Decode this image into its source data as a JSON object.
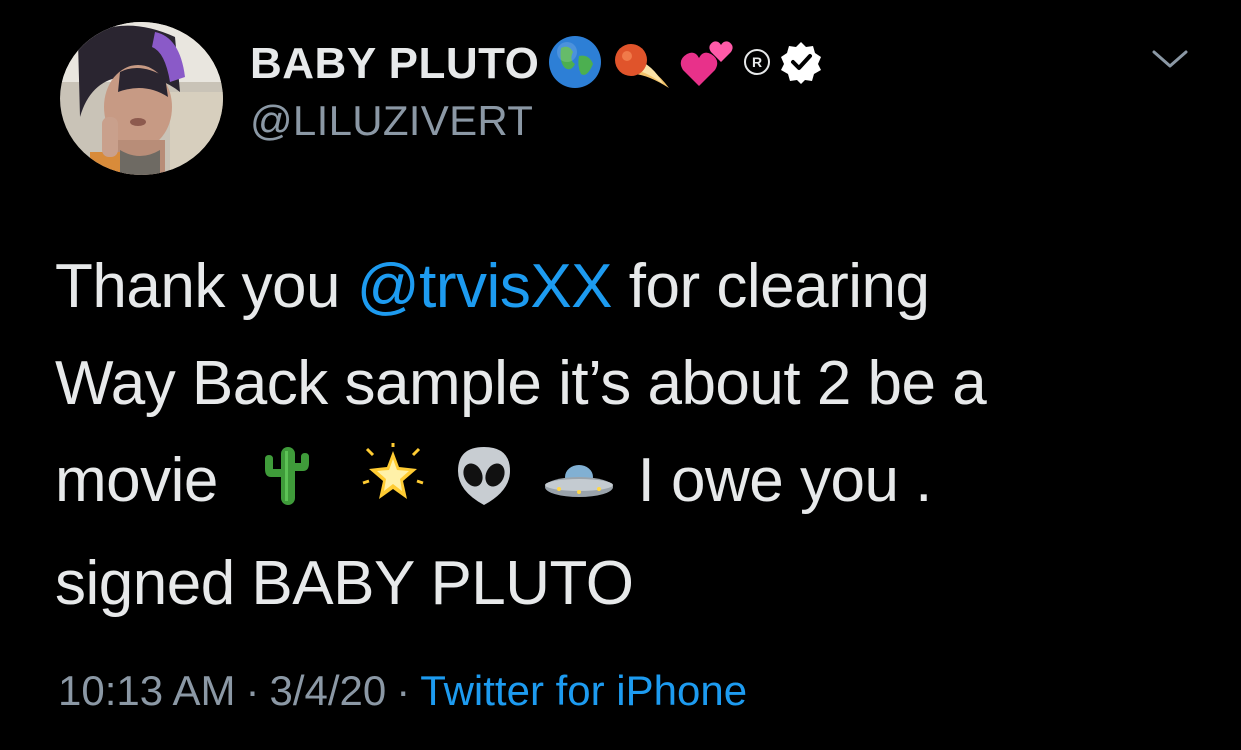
{
  "author": {
    "display_name": "BABY PLUTO",
    "handle": "@LILUZIVERT",
    "badges": [
      "globe-icon",
      "comet-icon",
      "two-hearts-icon",
      "registered-icon",
      "verified-badge-icon"
    ],
    "avatar_icon": "profile-photo"
  },
  "tweet": {
    "line1_before": "Thank you ",
    "mention": "@trvisXX",
    "line1_after": " for clearing",
    "line2": "Way Back sample it’s about 2 be a",
    "line3_start": "movie",
    "line3_emojis": [
      "cactus-icon",
      "glowing-star-icon",
      "alien-icon",
      "ufo-icon"
    ],
    "line3_end": "I owe you .",
    "line4": "signed BABY PLUTO"
  },
  "meta": {
    "time": "10:13 AM",
    "separator": "·",
    "date": "3/4/20",
    "source": "Twitter for iPhone"
  },
  "colors": {
    "background": "#000000",
    "text": "#e7e9ea",
    "secondary": "#8b98a5",
    "link": "#1d9bf0"
  },
  "menu": {
    "icon": "chevron-down-icon"
  }
}
